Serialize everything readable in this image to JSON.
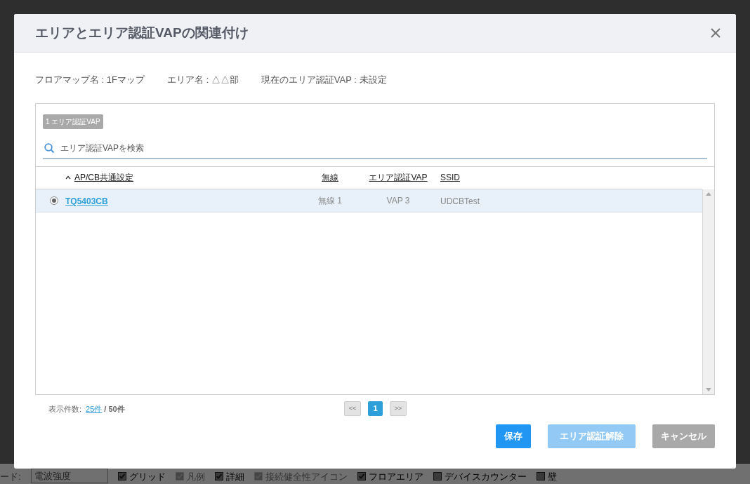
{
  "background": {
    "bottom_bar": {
      "mode_label": "ード:",
      "mode_select": "電波強度",
      "toggles": [
        {
          "label": "グリッド",
          "checked": true,
          "disabled": false
        },
        {
          "label": "凡例",
          "checked": true,
          "disabled": true
        },
        {
          "label": "詳細",
          "checked": true,
          "disabled": false
        },
        {
          "label": "接続健全性アイコン",
          "checked": true,
          "disabled": true
        },
        {
          "label": "フロアエリア",
          "checked": true,
          "disabled": false
        },
        {
          "label": "デバイスカウンター",
          "checked": false,
          "disabled": false
        },
        {
          "label": "壁",
          "checked": false,
          "disabled": false
        }
      ]
    }
  },
  "dialog": {
    "title": "エリアとエリア認証VAPの関連付け",
    "info": [
      "フロアマップ名 : 1Fマップ",
      "エリア名 : △△部",
      "現在のエリア認証VAP : 未設定"
    ],
    "panel": {
      "count_badge": "1 エリア認証VAP",
      "search": {
        "placeholder": "エリア認証VAPを検索"
      },
      "columns": [
        {
          "label": "AP/CB共通設定",
          "sorted": true
        },
        {
          "label": "無線",
          "sorted": false
        },
        {
          "label": "エリア認証VAP",
          "sorted": false
        },
        {
          "label": "SSID",
          "sorted": false
        }
      ],
      "rows": [
        {
          "selected": true,
          "name": "TQ5403CB",
          "radio": "無線 1",
          "vap": "VAP 3",
          "ssid": "UDCBTest"
        }
      ]
    },
    "pagination": {
      "label": "表示件数:",
      "page_size": "25件",
      "total": "/ 50件",
      "prev": "<<",
      "pages": [
        {
          "label": "1",
          "selected": true
        }
      ],
      "next": ">>"
    },
    "buttons": [
      {
        "label": "保存",
        "kind": "primary",
        "disabled": false
      },
      {
        "label": "エリア認証解除",
        "kind": "primary",
        "disabled": true
      },
      {
        "label": "キャンセル",
        "kind": "secondary",
        "disabled": false
      }
    ]
  }
}
